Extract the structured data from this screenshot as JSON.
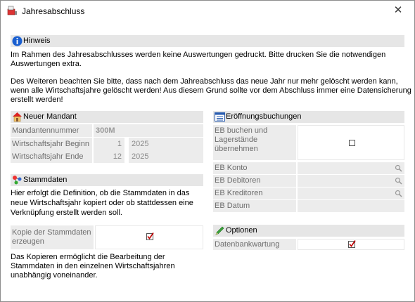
{
  "window": {
    "title": "Jahresabschluss",
    "close_glyph": "✕"
  },
  "hinweis": {
    "header": "Hinweis",
    "line1": "Im Rahmen des Jahresabschlusses werden keine Auswertungen gedruckt. Bitte drucken Sie die notwendigen",
    "line2": "Auswertungen extra.",
    "line3": "Des Weiteren beachten Sie bitte, dass nach dem Jahreabschluss das neue Jahr nur mehr gelöscht werden kann,",
    "line4": "wenn alle Wirtschaftsjahre gelöscht werden! Aus diesem Grund sollte vor dem Abschluss immer eine Datensicherung",
    "line5": "erstellt werden!"
  },
  "neuer_mandant": {
    "header": "Neuer Mandant",
    "mandantennummer_label": "Mandantennummer",
    "mandantennummer_value": "300M",
    "beginn_label": "Wirtschaftsjahr Beginn",
    "beginn_month": "1",
    "beginn_year": "2025",
    "ende_label": "Wirtschaftsjahr Ende",
    "ende_month": "12",
    "ende_year": "2025"
  },
  "stammdaten": {
    "header": "Stammdaten",
    "desc1": "Hier erfolgt die Definition, ob die Stammdaten in das",
    "desc2": "neue Wirtschaftsjahr kopiert oder ob stattdessen eine",
    "desc3": "Verknüpfung erstellt werden soll.",
    "kopie_label1": "Kopie der Stammdaten",
    "kopie_label2": "erzeugen",
    "kopie_checked": true,
    "note1": "Das Kopieren ermöglicht die Bearbeitung der",
    "note2": "Stammdaten in den einzelnen Wirtschaftsjahren",
    "note3": "unabhängig voneinander."
  },
  "eroeffnung": {
    "header": "Eröffnungsbuchungen",
    "eb_buchen_label1": "EB buchen und",
    "eb_buchen_label2": "Lagerstände",
    "eb_buchen_label3": "übernehmen",
    "eb_buchen_checked": false,
    "eb_konto": "EB Konto",
    "eb_debitoren": "EB Debitoren",
    "eb_kreditoren": "EB Kreditoren",
    "eb_datum": "EB Datum"
  },
  "optionen": {
    "header": "Optionen",
    "datenbankwartung_label": "Datenbankwartung",
    "datenbankwartung_checked": true
  },
  "colors": {
    "header_bg": "#e6e6e6",
    "field_bg": "#ececec",
    "check_red": "#c00000"
  }
}
